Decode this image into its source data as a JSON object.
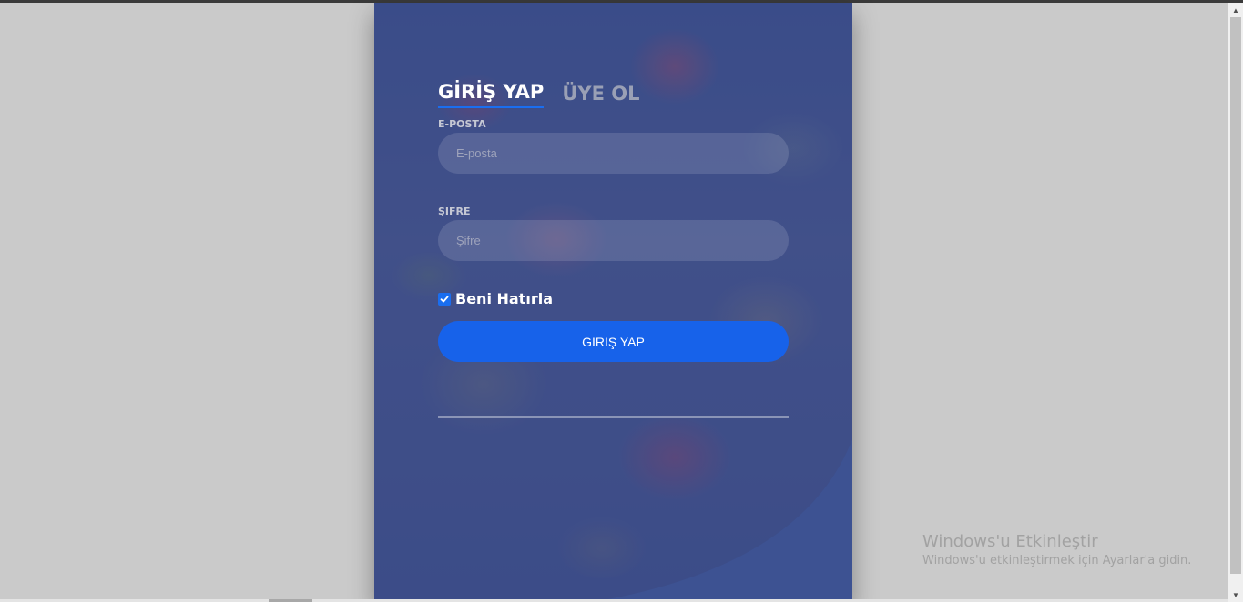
{
  "login": {
    "tabs": {
      "login": "GİRİŞ YAP",
      "signup": "ÜYE OL"
    },
    "email": {
      "label": "E-POSTA",
      "placeholder": "E-posta",
      "value": ""
    },
    "password": {
      "label": "ŞIFRE",
      "placeholder": "Şifre",
      "value": ""
    },
    "remember": {
      "label": "Beni Hatırla",
      "checked": true
    },
    "submit_label": "GIRIŞ YAP"
  },
  "watermark": {
    "title": "Windows'u Etkinleştir",
    "subtitle": "Windows'u etkinleştirmek için Ayarlar'a gidin."
  },
  "colors": {
    "accent": "#1762ea",
    "tab_underline": "#1a6ef0",
    "page_background": "#cacaca"
  },
  "icons": {
    "checkbox": "check-icon",
    "scroll_up": "chevron-up-icon",
    "scroll_down": "chevron-down-icon"
  }
}
